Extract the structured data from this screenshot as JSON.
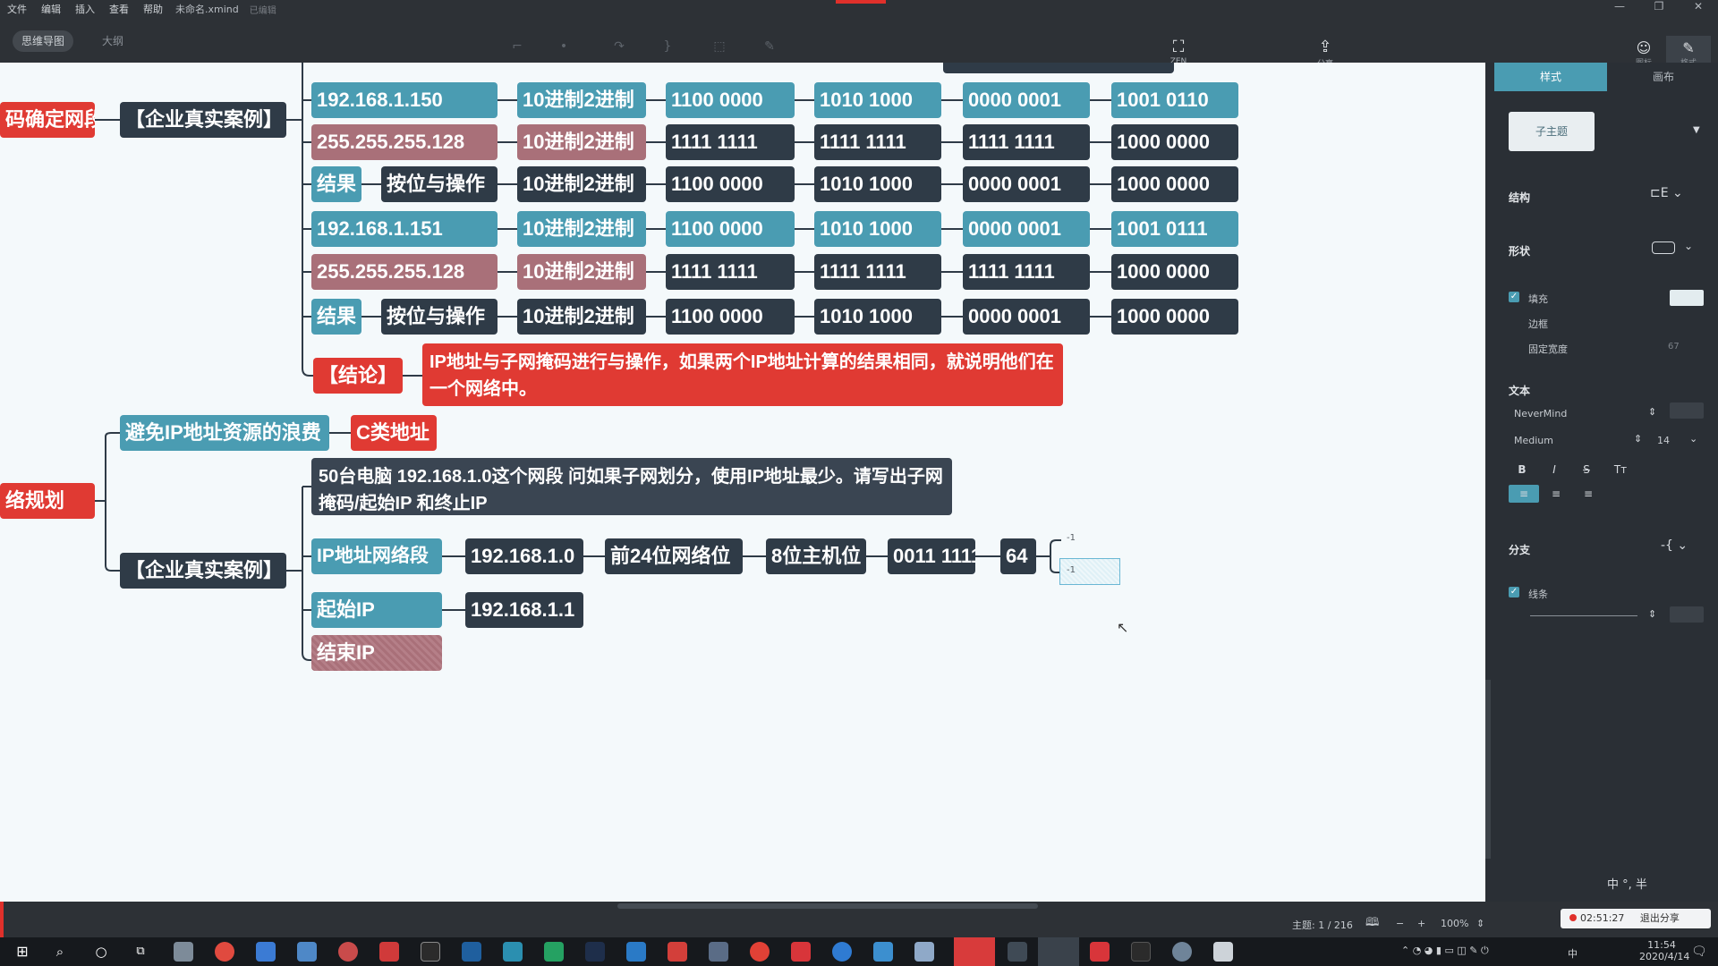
{
  "titlebar": {
    "menus": [
      "文件",
      "编辑",
      "插入",
      "查看",
      "帮助"
    ],
    "filename": "未命名.xmind",
    "status": "已编辑"
  },
  "toolbar": {
    "view_tabs": [
      "思维导图",
      "大纲"
    ],
    "zen_label": "ZEN",
    "share_label": "分享",
    "icon_label": "图标",
    "format_label": "格式"
  },
  "canvas": {
    "left_nodes": {
      "subnet_title": "码确定网段",
      "planning_title": "络规划"
    },
    "case1": {
      "label": "【企业真实案例】",
      "rows": [
        {
          "cells": [
            "192.168.1.150",
            "10进制2进制",
            "1100 0000",
            "1010 1000",
            "0000 0001",
            "1001 0110"
          ],
          "style": "teal"
        },
        {
          "cells": [
            "255.255.255.128",
            "10进制2进制",
            "1111   1111",
            "1111 1111",
            "1111 1111",
            "1000 0000"
          ],
          "style": "rose"
        },
        {
          "cells": [
            "结果",
            "按位与操作",
            "10进制2进制",
            "1100 0000",
            "1010 1000",
            "0000 0001",
            "1000 0000"
          ],
          "style": "result"
        },
        {
          "cells": [
            "192.168.1.151",
            "10进制2进制",
            "1100 0000",
            "1010 1000",
            "0000 0001",
            "1001 0111"
          ],
          "style": "teal"
        },
        {
          "cells": [
            "255.255.255.128",
            "10进制2进制",
            "1111 1111",
            "1111 1111",
            "1111 1111",
            "1000 0000"
          ],
          "style": "rose"
        },
        {
          "cells": [
            "结果",
            "按位与操作",
            "10进制2进制",
            "1100 0000",
            "1010 1000",
            "0000 0001",
            "1000 0000"
          ],
          "style": "result"
        }
      ],
      "conclusion_label": "【结论】",
      "conclusion_text": "IP地址与子网掩码进行与操作，如果两个IP地址计算的结果相同，就说明他们在一个网络中。"
    },
    "avoid": {
      "label": "避免IP地址资源的浪费",
      "class_c": "C类地址"
    },
    "case2": {
      "label": "【企业真实案例】",
      "question": "50台电脑 192.168.1.0这个网段 问如果子网划分，使用IP地址最少。请写出子网掩码/起始IP 和终止IP",
      "segment_row": [
        "IP地址网络段",
        "192.168.1.0",
        "前24位网络位",
        "8位主机位",
        "0011 1111",
        "64"
      ],
      "tiny_branch": [
        "-1",
        "-1"
      ],
      "start_ip_label": "起始IP",
      "start_ip_value": "192.168.1.1",
      "end_ip_label": "结束IP"
    }
  },
  "panel": {
    "tabs": [
      "样式",
      "画布"
    ],
    "theme_card": "子主题",
    "structure": "结构",
    "shape": "形状",
    "fill": "填充",
    "border": "边框",
    "fixed_width": "固定宽度",
    "fixed_width_value": "67",
    "text": "文本",
    "font": "NeverMind",
    "weight": "Medium",
    "size": "14",
    "branch": "分支",
    "line": "线条",
    "format_buttons": [
      "B",
      "I",
      "S",
      "Tт"
    ]
  },
  "statusbar": {
    "topic_count": "主题: 1 / 216",
    "zoom": "100%",
    "rec_time": "02:51:27",
    "rec_exit": "退出分享",
    "ime": "中 °, 半"
  },
  "taskbar": {
    "time": "11:54",
    "date": "2020/4/14",
    "ime": "中"
  }
}
